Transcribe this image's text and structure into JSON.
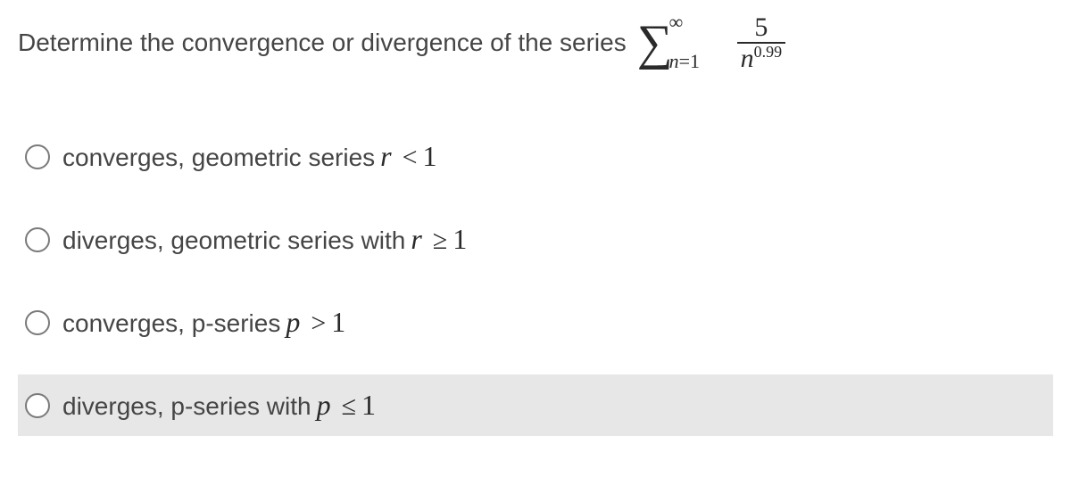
{
  "question": {
    "prompt": "Determine the convergence or divergence of the series",
    "sigma": {
      "upper": "∞",
      "lower_var": "n",
      "lower_eq": "=1"
    },
    "fraction": {
      "numerator": "5",
      "den_base": "n",
      "den_exp": "0.99"
    }
  },
  "options": [
    {
      "prefix": "converges, geometric series",
      "var": "r",
      "op": "<",
      "rhs": "1",
      "hover": false
    },
    {
      "prefix": "diverges, geometric series with ",
      "var": "r",
      "op": "≥",
      "rhs": "1",
      "hover": false
    },
    {
      "prefix": "converges, p-series",
      "var": "p",
      "op": ">",
      "rhs": "1",
      "hover": false
    },
    {
      "prefix": "diverges, p-series with",
      "var": "p",
      "op": "≤",
      "rhs": "1",
      "hover": true
    }
  ]
}
